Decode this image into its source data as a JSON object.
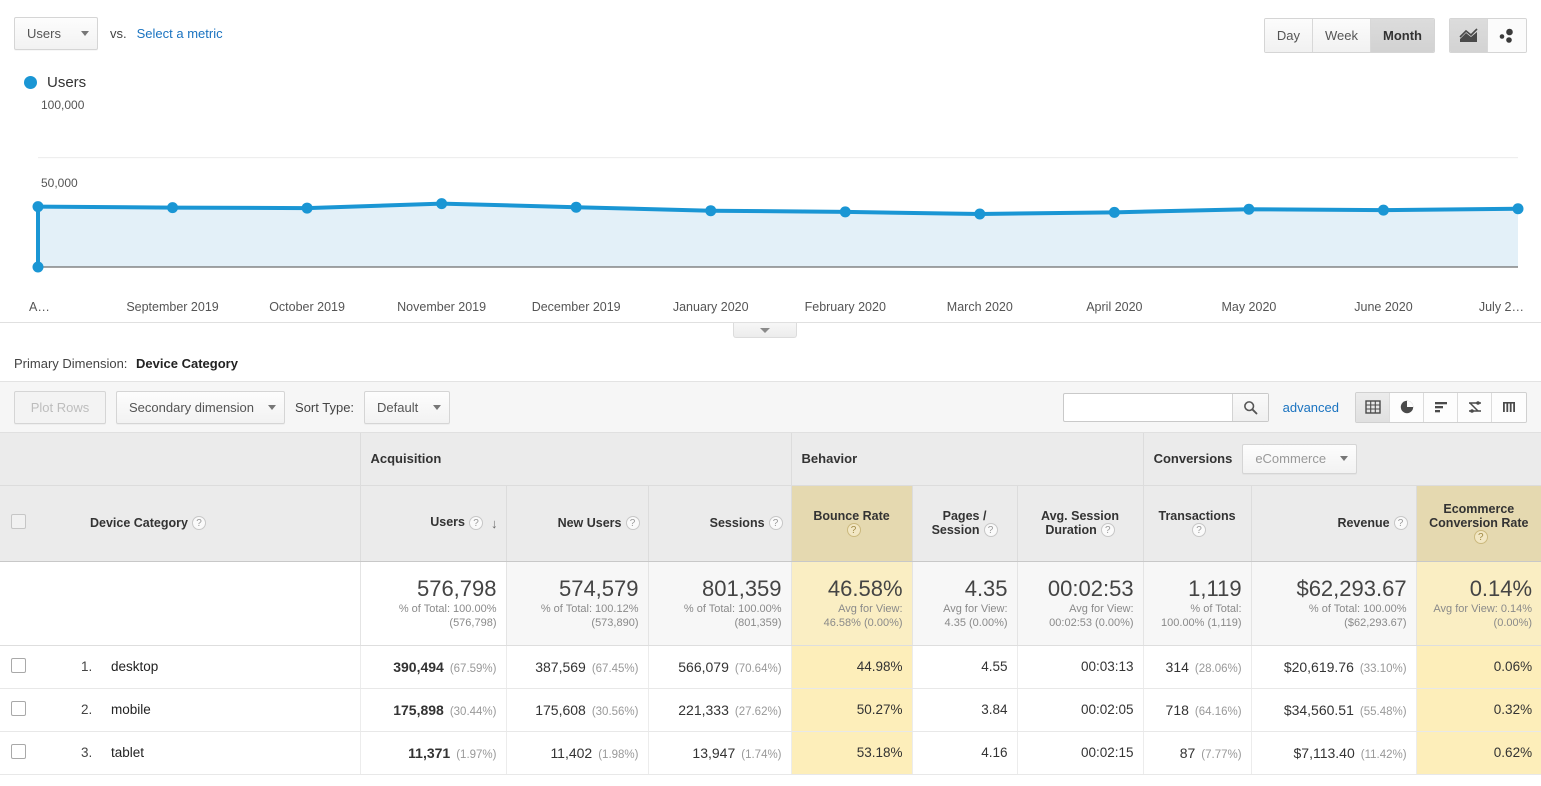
{
  "metric_bar": {
    "metric_button": "Users",
    "vs_label": "vs.",
    "select_metric_link": "Select a metric",
    "granularity": [
      "Day",
      "Week",
      "Month"
    ],
    "granularity_selected": "Month",
    "chart_type_icons": [
      "line-chart-icon",
      "motion-chart-icon"
    ]
  },
  "chart": {
    "legend_label": "Users",
    "accent_color": "#1a96d4",
    "fill_color": "#e3f0f8"
  },
  "chart_data": {
    "type": "line",
    "title": "Users",
    "xlabel": "",
    "ylabel": "Users",
    "ylim": [
      0,
      150000
    ],
    "yticks": [
      "50,000",
      "100,000"
    ],
    "grid": true,
    "legend_position": "top-left",
    "categories": [
      "A…",
      "September 2019",
      "October 2019",
      "November 2019",
      "December 2019",
      "January 2020",
      "February 2020",
      "March 2020",
      "April 2020",
      "May 2020",
      "June 2020",
      "July 2…"
    ],
    "series": [
      {
        "name": "Users",
        "values": [
          55200,
          54300,
          53900,
          58000,
          54700,
          51500,
          50400,
          48500,
          50000,
          52800,
          52000,
          53300
        ]
      }
    ]
  },
  "primary_dimension": {
    "label": "Primary Dimension:",
    "value": "Device Category"
  },
  "table_toolbar": {
    "plot_rows": "Plot Rows",
    "secondary_dimension": "Secondary dimension",
    "sort_type_label": "Sort Type:",
    "sort_type_value": "Default",
    "search_value": "",
    "search_placeholder": "",
    "advanced": "advanced",
    "view_icons": [
      "table-view-icon",
      "pie-chart-view-icon",
      "bar-chart-view-icon",
      "comparison-view-icon",
      "pivot-view-icon"
    ],
    "view_selected": "table-view-icon"
  },
  "table": {
    "groups": {
      "acquisition": "Acquisition",
      "behavior": "Behavior",
      "conversions": "Conversions",
      "conversions_select": "eCommerce"
    },
    "dimension_header": "Device Category",
    "columns": [
      "Users",
      "New Users",
      "Sessions",
      "Bounce Rate",
      "Pages / Session",
      "Avg. Session Duration",
      "Transactions",
      "Revenue",
      "Ecommerce Conversion Rate"
    ],
    "sorted_column": "Users",
    "sort_direction": "descending",
    "summary": [
      {
        "value": "576,798",
        "sub": "% of Total: 100.00% (576,798)"
      },
      {
        "value": "574,579",
        "sub": "% of Total: 100.12% (573,890)"
      },
      {
        "value": "801,359",
        "sub": "% of Total: 100.00% (801,359)"
      },
      {
        "value": "46.58%",
        "sub": "Avg for View: 46.58% (0.00%)"
      },
      {
        "value": "4.35",
        "sub": "Avg for View: 4.35 (0.00%)"
      },
      {
        "value": "00:02:53",
        "sub": "Avg for View: 00:02:53 (0.00%)"
      },
      {
        "value": "1,119",
        "sub": "% of Total: 100.00% (1,119)"
      },
      {
        "value": "$62,293.67",
        "sub": "% of Total: 100.00% ($62,293.67)"
      },
      {
        "value": "0.14%",
        "sub": "Avg for View: 0.14% (0.00%)"
      }
    ],
    "rows": [
      {
        "rank": "1.",
        "name": "desktop",
        "users": "390,494",
        "users_pct": "(67.59%)",
        "new_users": "387,569",
        "new_users_pct": "(67.45%)",
        "sessions": "566,079",
        "sessions_pct": "(70.64%)",
        "bounce_rate": "44.98%",
        "pages_session": "4.55",
        "avg_duration": "00:03:13",
        "transactions": "314",
        "transactions_pct": "(28.06%)",
        "revenue": "$20,619.76",
        "revenue_pct": "(33.10%)",
        "ecom_rate": "0.06%"
      },
      {
        "rank": "2.",
        "name": "mobile",
        "users": "175,898",
        "users_pct": "(30.44%)",
        "new_users": "175,608",
        "new_users_pct": "(30.56%)",
        "sessions": "221,333",
        "sessions_pct": "(27.62%)",
        "bounce_rate": "50.27%",
        "pages_session": "3.84",
        "avg_duration": "00:02:05",
        "transactions": "718",
        "transactions_pct": "(64.16%)",
        "revenue": "$34,560.51",
        "revenue_pct": "(55.48%)",
        "ecom_rate": "0.32%"
      },
      {
        "rank": "3.",
        "name": "tablet",
        "users": "11,371",
        "users_pct": "(1.97%)",
        "new_users": "11,402",
        "new_users_pct": "(1.98%)",
        "sessions": "13,947",
        "sessions_pct": "(1.74%)",
        "bounce_rate": "53.18%",
        "pages_session": "4.16",
        "avg_duration": "00:02:15",
        "transactions": "87",
        "transactions_pct": "(7.77%)",
        "revenue": "$7,113.40",
        "revenue_pct": "(11.42%)",
        "ecom_rate": "0.62%"
      }
    ]
  }
}
